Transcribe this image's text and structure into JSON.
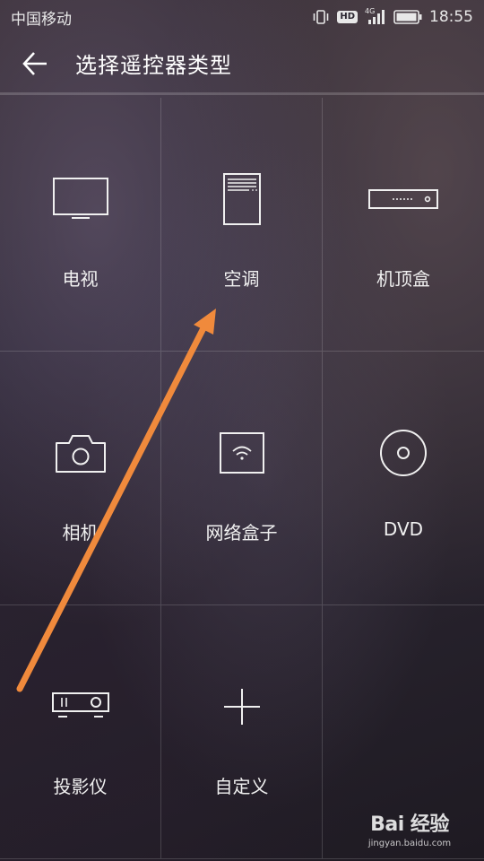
{
  "status_bar": {
    "carrier": "中国移动",
    "network": "4G",
    "hd": "HD",
    "time": "18:55"
  },
  "header": {
    "title": "选择遥控器类型"
  },
  "grid": {
    "items": [
      {
        "label": "电视",
        "icon": "tv-icon"
      },
      {
        "label": "空调",
        "icon": "air-conditioner-icon"
      },
      {
        "label": "机顶盒",
        "icon": "set-top-box-icon"
      },
      {
        "label": "相机",
        "icon": "camera-icon"
      },
      {
        "label": "网络盒子",
        "icon": "network-box-icon"
      },
      {
        "label": "DVD",
        "icon": "dvd-icon"
      },
      {
        "label": "投影仪",
        "icon": "projector-icon"
      },
      {
        "label": "自定义",
        "icon": "plus-icon"
      }
    ]
  },
  "annotation": {
    "arrow_color": "#F08A3C"
  },
  "watermark": {
    "logo": "Bai 经验",
    "url": "jingyan.baidu.com"
  }
}
